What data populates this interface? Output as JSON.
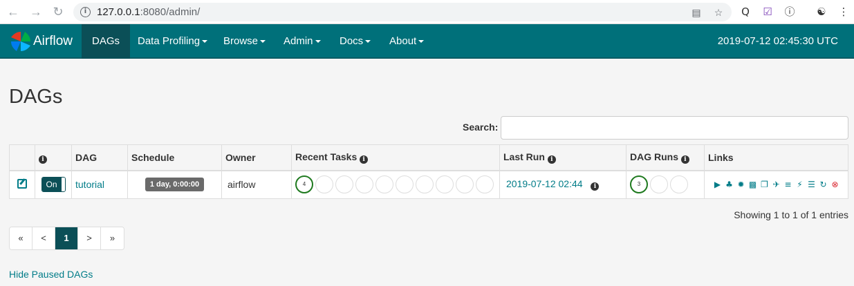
{
  "browser": {
    "url_host": "127.0.0.1",
    "url_rest": ":8080/admin/"
  },
  "nav": {
    "brand": "Airflow",
    "items": [
      {
        "label": "DAGs",
        "active": true,
        "dropdown": false
      },
      {
        "label": "Data Profiling",
        "dropdown": true
      },
      {
        "label": "Browse",
        "dropdown": true
      },
      {
        "label": "Admin",
        "dropdown": true
      },
      {
        "label": "Docs",
        "dropdown": true
      },
      {
        "label": "About",
        "dropdown": true
      }
    ],
    "clock": "2019-07-12 02:45:30 UTC"
  },
  "page": {
    "title": "DAGs",
    "search_label": "Search:",
    "search_value": ""
  },
  "table": {
    "headers": {
      "dag": "DAG",
      "schedule": "Schedule",
      "owner": "Owner",
      "recent_tasks": "Recent Tasks",
      "last_run": "Last Run",
      "dag_runs": "DAG Runs",
      "links": "Links"
    },
    "rows": [
      {
        "toggle": "On",
        "dag": "tutorial",
        "schedule": "1 day, 0:00:00",
        "owner": "airflow",
        "recent_tasks_count": "4",
        "last_run": "2019-07-12 02:44",
        "dag_runs_count": "3"
      }
    ]
  },
  "showing": "Showing 1 to 1 of 1 entries",
  "pager": {
    "first": "«",
    "prev": "<",
    "current": "1",
    "next": ">",
    "last": "»"
  },
  "hide_paused": "Hide Paused DAGs"
}
